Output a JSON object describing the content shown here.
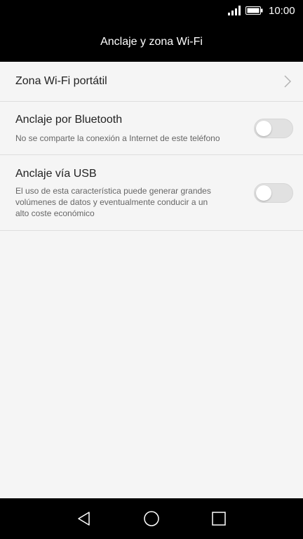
{
  "status_bar": {
    "time": "10:00",
    "icons": [
      "signal-icon",
      "battery-icon"
    ]
  },
  "header": {
    "title": "Anclaje y zona Wi-Fi"
  },
  "settings": [
    {
      "title": "Zona Wi-Fi portátil",
      "control": "chevron-right-icon"
    },
    {
      "title": "Anclaje por Bluetooth",
      "description": "No se comparte la conexión a Internet de este teléfono",
      "toggle_on": false
    },
    {
      "title": "Anclaje vía USB",
      "description_lines": [
        "El uso de esta característica puede generar grandes",
        "volúmenes de datos y eventualmente conducir a un",
        "alto coste económico"
      ],
      "toggle_on": false
    }
  ],
  "nav_bar": {
    "icons": [
      "back-icon",
      "home-icon",
      "recents-icon"
    ]
  }
}
